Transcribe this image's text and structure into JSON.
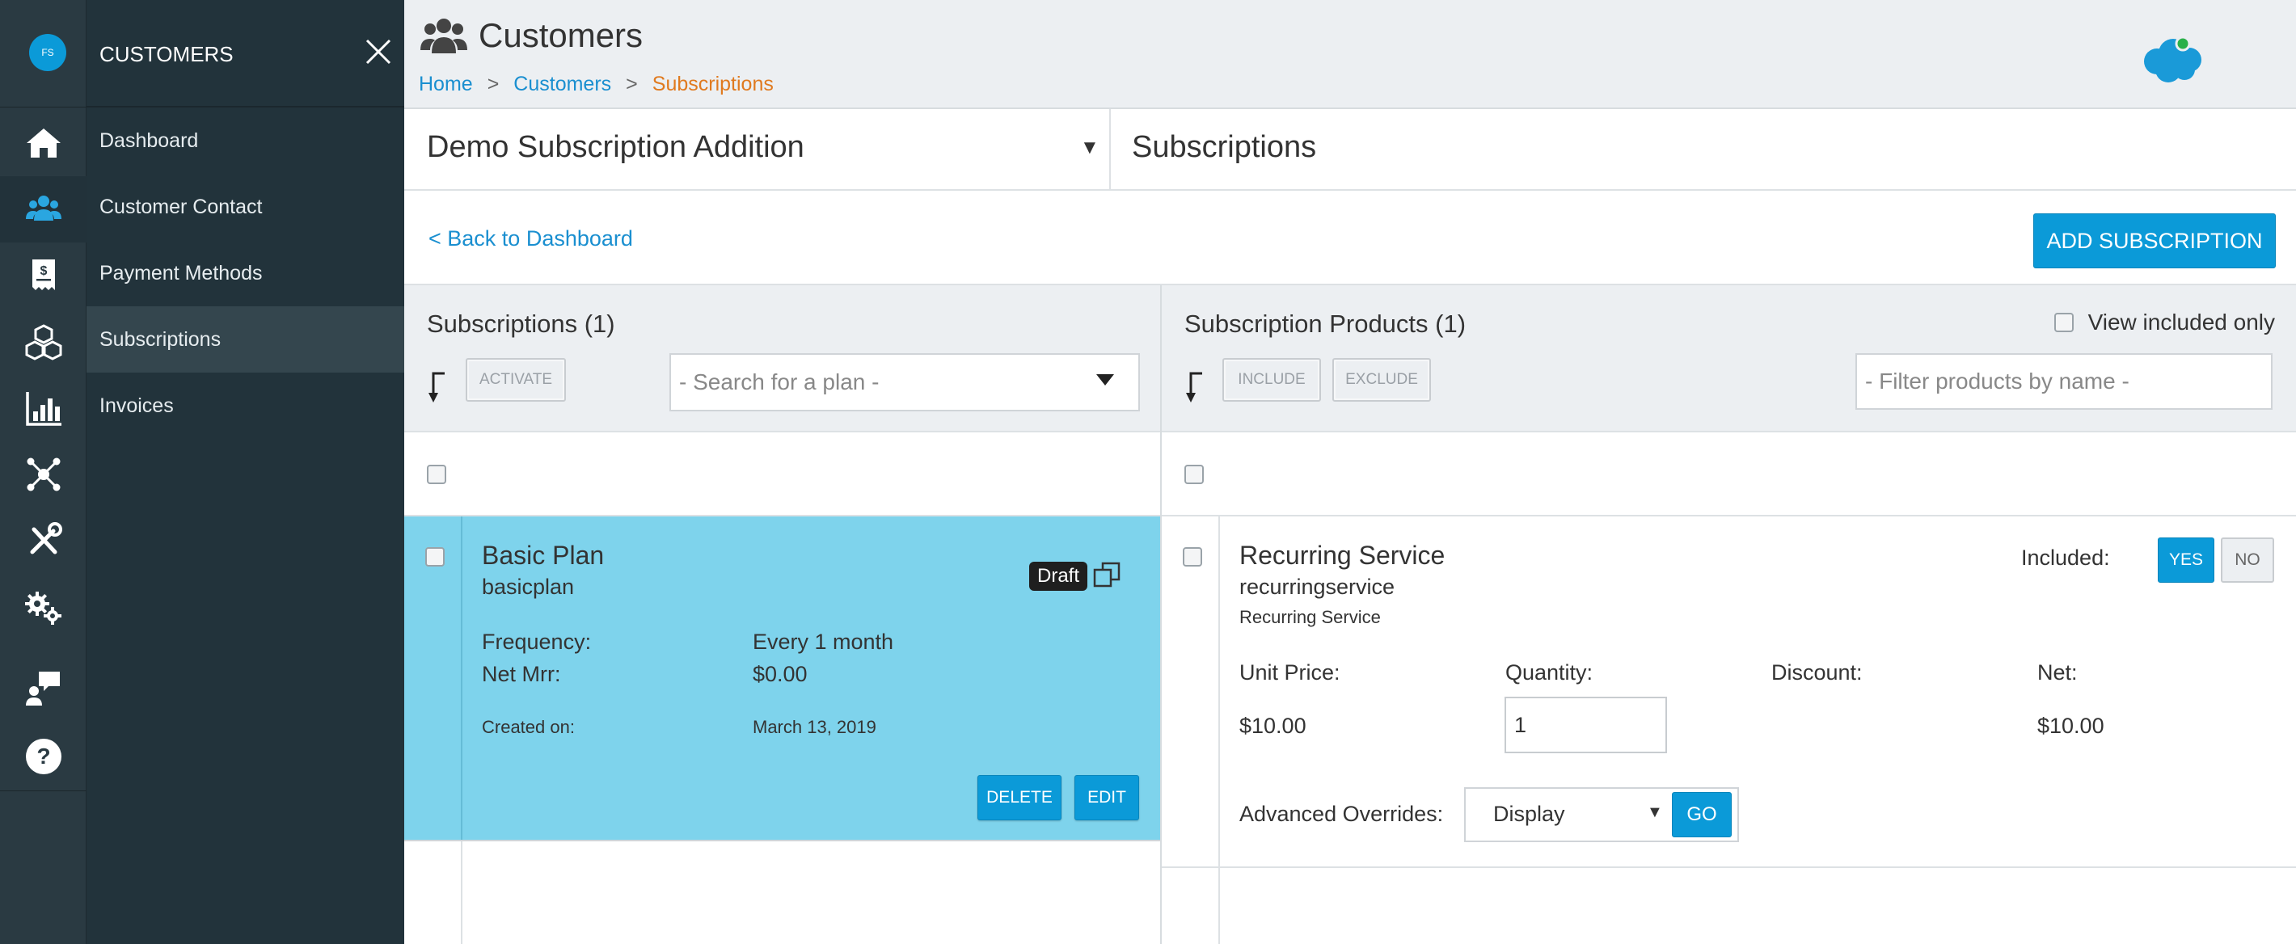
{
  "user": {
    "initials": "FS"
  },
  "nav": {
    "title": "CUSTOMERS",
    "items": [
      {
        "label": "Dashboard"
      },
      {
        "label": "Customer Contact"
      },
      {
        "label": "Payment Methods"
      },
      {
        "label": "Subscriptions"
      },
      {
        "label": "Invoices"
      }
    ]
  },
  "header": {
    "title": "Customers",
    "breadcrumb": [
      "Home",
      "Customers",
      "Subscriptions"
    ],
    "breadcrumb_sep": ">"
  },
  "title_row": {
    "selected_customer": "Demo Subscription Addition",
    "section_title": "Subscriptions"
  },
  "actions": {
    "back_label": "< Back to Dashboard",
    "add_label": "ADD SUBSCRIPTION"
  },
  "subscriptions_panel": {
    "title": "Subscriptions (1)",
    "activate_label": "ACTIVATE",
    "search_placeholder": "- Search for a plan -",
    "plan": {
      "name": "Basic Plan",
      "code": "basicplan",
      "status": "Draft",
      "frequency_label": "Frequency:",
      "frequency_value": "Every 1 month",
      "net_mrr_label": "Net Mrr:",
      "net_mrr_value": "$0.00",
      "created_label": "Created on:",
      "created_value": "March 13, 2019",
      "delete_label": "DELETE",
      "edit_label": "EDIT"
    }
  },
  "products_panel": {
    "title": "Subscription Products (1)",
    "view_included_label": "View included only",
    "include_label": "INCLUDE",
    "exclude_label": "EXCLUDE",
    "filter_placeholder": "- Filter products by name -",
    "product": {
      "name": "Recurring Service",
      "code": "recurringservice",
      "description": "Recurring Service",
      "included_label": "Included:",
      "yes_label": "YES",
      "no_label": "NO",
      "unit_price_label": "Unit Price:",
      "unit_price_value": "$10.00",
      "quantity_label": "Quantity:",
      "quantity_value": "1",
      "discount_label": "Discount:",
      "net_label": "Net:",
      "net_value": "$10.00",
      "overrides_label": "Advanced Overrides:",
      "overrides_value": "Display",
      "go_label": "GO"
    }
  },
  "colors": {
    "accent": "#0b9ad8",
    "breadcrumb_current": "#e07a1f",
    "selected_card": "#7ed3ec",
    "sidebar": "#22333b"
  }
}
